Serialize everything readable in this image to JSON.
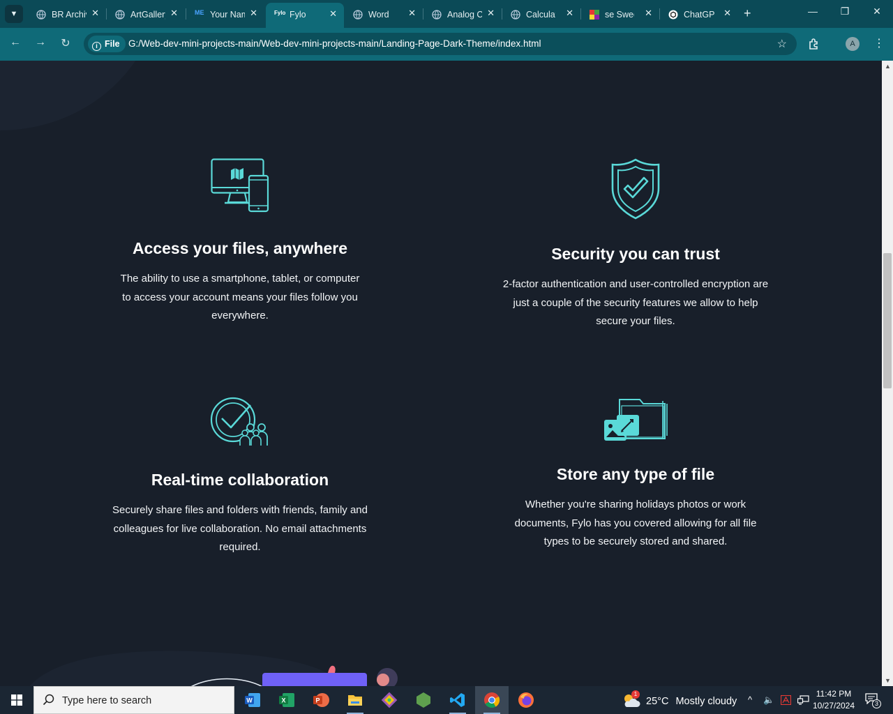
{
  "browser": {
    "tabs": [
      {
        "title": "BR Archive",
        "favicon": "globe-icon"
      },
      {
        "title": "ArtGallery",
        "favicon": "globe-icon"
      },
      {
        "title": "Your Name",
        "favicon": "me-icon"
      },
      {
        "title": "Fylo",
        "favicon": "fylo-icon",
        "active": true
      },
      {
        "title": "Word Counter",
        "favicon": "globe-icon"
      },
      {
        "title": "Analog Clock",
        "favicon": "globe-icon"
      },
      {
        "title": "Calculator",
        "favicon": "globe-icon"
      },
      {
        "title": "se Swedish",
        "favicon": "grid-icon"
      },
      {
        "title": "ChatGPT",
        "favicon": "chatgpt-icon"
      }
    ],
    "fylo_favicon_text": "Fylo",
    "me_favicon_text": "ME",
    "address_scheme_label": "File",
    "url": "G:/Web-dev-mini-projects-main/Web-dev-mini-projects-main/Landing-Page-Dark-Theme/index.html",
    "profile_initial": "A",
    "accent_color": "#0f6a78"
  },
  "page": {
    "background_color": "#181f2a",
    "icon_color": "#5ad9d8",
    "features": [
      {
        "title": "Access your files, anywhere",
        "text": "The ability to use a smartphone, tablet, or computer to access your account means your files follow you everywhere.",
        "icon": "devices-icon"
      },
      {
        "title": "Security you can trust",
        "text": "2-factor authentication and user-controlled encryption are just a couple of the security features we allow to help secure your files.",
        "icon": "shield-check-icon"
      },
      {
        "title": "Real-time collaboration",
        "text": "Securely share files and folders with friends, family and colleagues for live collaboration. No email attachments required.",
        "icon": "collaboration-icon"
      },
      {
        "title": "Store any type of file",
        "text": "Whether you're sharing holidays photos or work documents, Fylo has you covered allowing for all file types to be securely stored and shared.",
        "icon": "folder-files-icon"
      }
    ]
  },
  "taskbar": {
    "search_placeholder": "Type here to search",
    "apps": [
      "word-icon",
      "excel-icon",
      "powerpoint-icon",
      "file-explorer-icon",
      "git-icon",
      "nodejs-icon",
      "vscode-icon",
      "chrome-icon",
      "firefox-icon"
    ],
    "weather_temp": "25°C",
    "weather_desc": "Mostly cloudy",
    "time": "11:42 PM",
    "date": "10/27/2024",
    "notification_count": "3",
    "weather_alert_count": "1"
  }
}
